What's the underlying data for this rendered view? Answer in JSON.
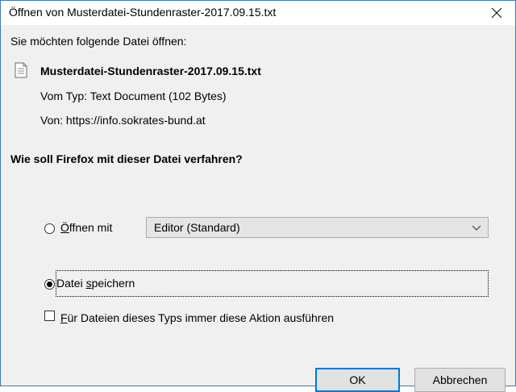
{
  "window": {
    "title": "Öffnen von Musterdatei-Stundenraster-2017.09.15.txt",
    "close_label": "×"
  },
  "dialog": {
    "prompt": "Sie möchten folgende Datei öffnen:",
    "file_name": "Musterdatei-Stundenraster-2017.09.15.txt",
    "type_prefix": "Vom Typ:",
    "type_value": "Text Document (102 Bytes)",
    "from_prefix": "Von:",
    "from_value": "https://info.sokrates-bund.at",
    "question": "Wie soll Firefox mit dieser Datei verfahren?"
  },
  "options": {
    "open_with": {
      "accesskey": "Ö",
      "label_rest": "ffnen mit",
      "checked": false
    },
    "open_with_app": {
      "selected": "Editor (Standard)"
    },
    "save_file": {
      "label_start": "Datei ",
      "accesskey": "s",
      "label_rest": "peichern",
      "checked": true
    },
    "always": {
      "accesskey": "F",
      "label_rest": "ür Dateien dieses Typs immer diese Aktion ausführen",
      "checked": false
    }
  },
  "buttons": {
    "ok": "OK",
    "cancel": "Abbrechen"
  },
  "colors": {
    "window_border": "#3b78b4",
    "content_bg": "#f0f0f0",
    "default_button_border": "#0078d7"
  }
}
